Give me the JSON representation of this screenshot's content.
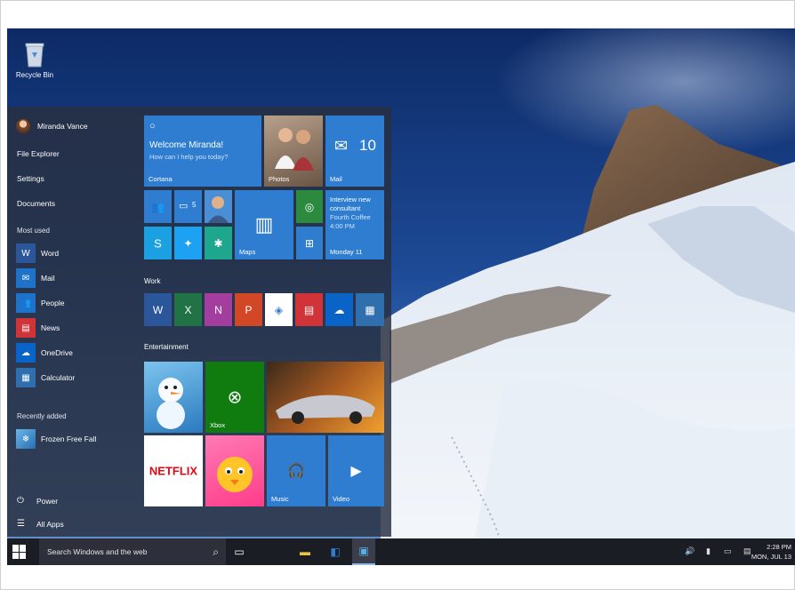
{
  "desktop": {
    "recycle_bin_label": "Recycle Bin"
  },
  "start_menu": {
    "user_name": "Miranda Vance",
    "places": [
      "File Explorer",
      "Settings",
      "Documents"
    ],
    "most_used_label": "Most used",
    "most_used": [
      {
        "label": "Word",
        "color": "#2b579a",
        "icon": "word-icon"
      },
      {
        "label": "Mail",
        "color": "#1e73c9",
        "icon": "mail-icon"
      },
      {
        "label": "People",
        "color": "#1e73c9",
        "icon": "people-icon"
      },
      {
        "label": "News",
        "color": "#d13438",
        "icon": "news-icon"
      },
      {
        "label": "OneDrive",
        "color": "#0a64c8",
        "icon": "onedrive-icon"
      },
      {
        "label": "Calculator",
        "color": "#2f6fae",
        "icon": "calculator-icon"
      }
    ],
    "recently_added_label": "Recently added",
    "recently_added": [
      {
        "label": "Frozen Free Fall",
        "icon": "frozen-free-fall-icon"
      }
    ],
    "power_label": "Power",
    "all_apps_label": "All Apps",
    "tiles": {
      "cortana": {
        "greeting": "Welcome Miranda!",
        "prompt": "How can I help you today?",
        "label": "Cortana"
      },
      "photos": {
        "label": "Photos"
      },
      "mail": {
        "count": "10",
        "label": "Mail"
      },
      "people_count": "5",
      "maps": {
        "label": "Maps"
      },
      "calendar": {
        "line1": "Interview new",
        "line2": "consultant",
        "line3": "Fourth Coffee",
        "line4": "4:00 PM",
        "label": "Monday 11"
      },
      "work_group": "Work",
      "entertainment_group": "Entertainment",
      "xbox": {
        "label": "Xbox"
      },
      "netflix": {
        "text": "NETFLIX"
      },
      "music": {
        "label": "Music"
      },
      "video": {
        "label": "Video"
      }
    }
  },
  "taskbar": {
    "search_placeholder": "Search Windows and the web",
    "time": "2:28 PM",
    "date": "MON, JUL 13"
  },
  "colors": {
    "tile_blue": "#2e7dd1",
    "start_bg": "#283040",
    "taskbar_bg": "#1b1d25",
    "accent_blue": "#1e73c9"
  }
}
